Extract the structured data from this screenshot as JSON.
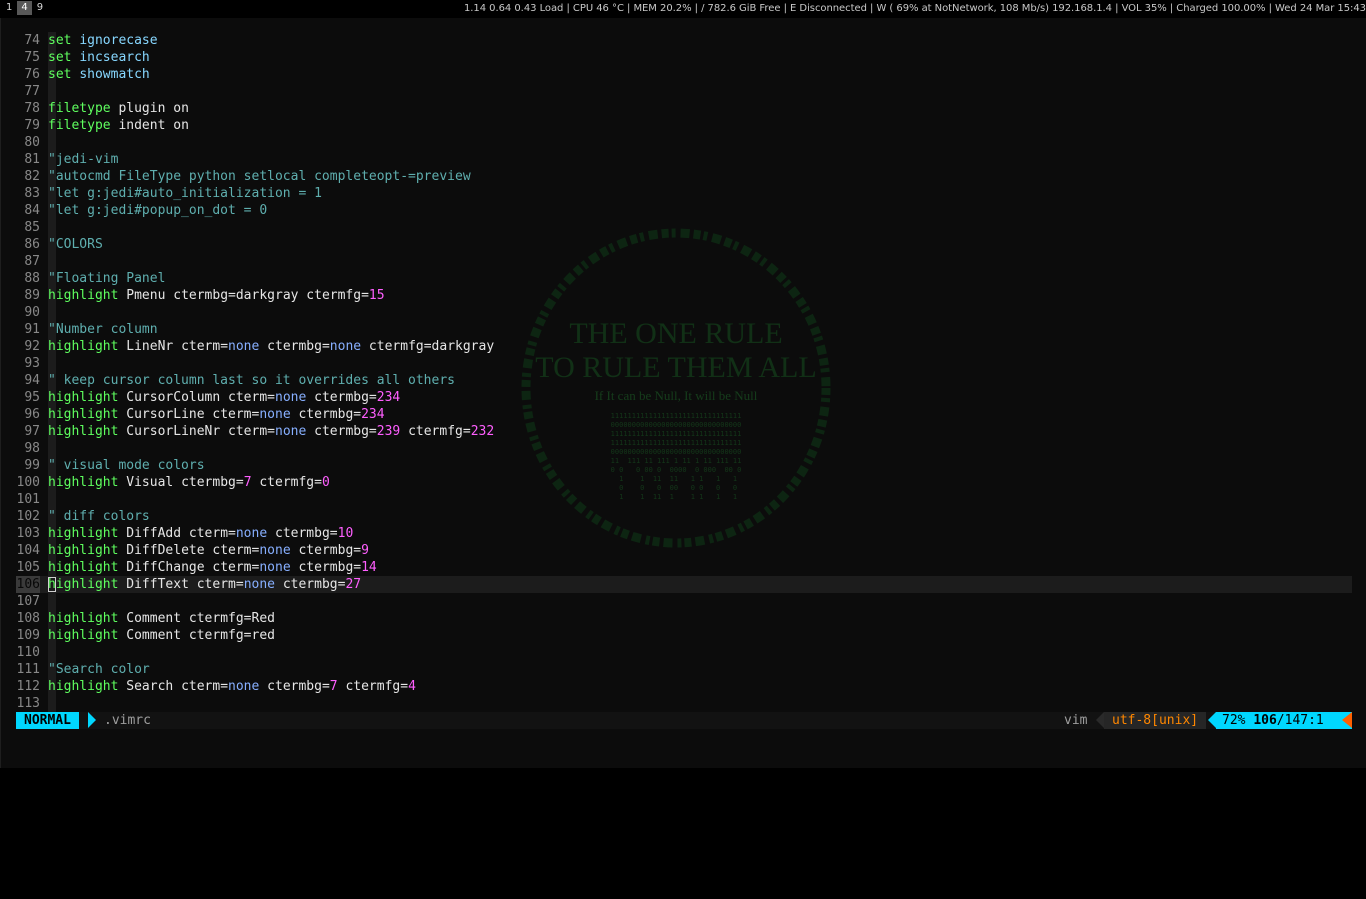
{
  "topbar": {
    "workspaces": [
      {
        "label": "1",
        "active": false
      },
      {
        "label": "4",
        "active": true
      },
      {
        "label": "9",
        "active": false
      }
    ],
    "status": "1.14 0.64 0.43 Load  | CPU 46 °C | MEM 20.2% | / 782.6 GiB Free | E Disconnected | W ( 69% at NotNetwork, 108 Mb/s) 192.168.1.4 | VOL 35% | Charged 100.00% | Wed 24 Mar 15:43"
  },
  "editor": {
    "lines": [
      {
        "n": "74",
        "tokens": [
          [
            "cmd",
            "set"
          ],
          [
            "plain",
            " "
          ],
          [
            "kw",
            "ignorecase"
          ]
        ]
      },
      {
        "n": "75",
        "tokens": [
          [
            "cmd",
            "set"
          ],
          [
            "plain",
            " "
          ],
          [
            "kw",
            "incsearch"
          ]
        ]
      },
      {
        "n": "76",
        "tokens": [
          [
            "cmd",
            "set"
          ],
          [
            "plain",
            " "
          ],
          [
            "kw",
            "showmatch"
          ]
        ]
      },
      {
        "n": "77",
        "tokens": []
      },
      {
        "n": "78",
        "tokens": [
          [
            "cmd",
            "filetype"
          ],
          [
            "plain",
            " plugin on"
          ]
        ]
      },
      {
        "n": "79",
        "tokens": [
          [
            "cmd",
            "filetype"
          ],
          [
            "plain",
            " indent on"
          ]
        ]
      },
      {
        "n": "80",
        "tokens": []
      },
      {
        "n": "81",
        "tokens": [
          [
            "cmt",
            "\"jedi-vim"
          ]
        ]
      },
      {
        "n": "82",
        "tokens": [
          [
            "cmt",
            "\"autocmd FileType python setlocal completeopt-=preview"
          ]
        ]
      },
      {
        "n": "83",
        "tokens": [
          [
            "cmt",
            "\"let g:jedi#auto_initialization = 1"
          ]
        ]
      },
      {
        "n": "84",
        "tokens": [
          [
            "cmt",
            "\"let g:jedi#popup_on_dot = 0"
          ]
        ]
      },
      {
        "n": "85",
        "tokens": []
      },
      {
        "n": "86",
        "tokens": [
          [
            "cmt",
            "\"COLORS"
          ]
        ]
      },
      {
        "n": "87",
        "tokens": []
      },
      {
        "n": "88",
        "tokens": [
          [
            "cmt",
            "\"Floating Panel"
          ]
        ]
      },
      {
        "n": "89",
        "tokens": [
          [
            "cmd",
            "highlight"
          ],
          [
            "plain",
            " Pmenu ctermbg=darkgray ctermfg="
          ],
          [
            "num",
            "15"
          ]
        ]
      },
      {
        "n": "90",
        "tokens": []
      },
      {
        "n": "91",
        "tokens": [
          [
            "cmt",
            "\"Number column"
          ]
        ]
      },
      {
        "n": "92",
        "tokens": [
          [
            "cmd",
            "highlight"
          ],
          [
            "plain",
            " LineNr cterm="
          ],
          [
            "none",
            "none"
          ],
          [
            "plain",
            " ctermbg="
          ],
          [
            "none",
            "none"
          ],
          [
            "plain",
            " ctermfg=darkgray"
          ]
        ]
      },
      {
        "n": "93",
        "tokens": []
      },
      {
        "n": "94",
        "tokens": [
          [
            "cmt",
            "\" keep cursor column last so it overrides all others"
          ]
        ]
      },
      {
        "n": "95",
        "tokens": [
          [
            "cmd",
            "highlight"
          ],
          [
            "plain",
            " CursorColumn cterm="
          ],
          [
            "none",
            "none"
          ],
          [
            "plain",
            " ctermbg="
          ],
          [
            "num",
            "234"
          ]
        ]
      },
      {
        "n": "96",
        "tokens": [
          [
            "cmd",
            "highlight"
          ],
          [
            "plain",
            " CursorLine cterm="
          ],
          [
            "none",
            "none"
          ],
          [
            "plain",
            " ctermbg="
          ],
          [
            "num",
            "234"
          ]
        ]
      },
      {
        "n": "97",
        "tokens": [
          [
            "cmd",
            "highlight"
          ],
          [
            "plain",
            " CursorLineNr cterm="
          ],
          [
            "none",
            "none"
          ],
          [
            "plain",
            " ctermbg="
          ],
          [
            "num",
            "239"
          ],
          [
            "plain",
            " ctermfg="
          ],
          [
            "num",
            "232"
          ]
        ]
      },
      {
        "n": "98",
        "tokens": []
      },
      {
        "n": "99",
        "tokens": [
          [
            "cmt",
            "\" visual mode colors"
          ]
        ]
      },
      {
        "n": "100",
        "tokens": [
          [
            "cmd",
            "highlight"
          ],
          [
            "plain",
            " Visual ctermbg="
          ],
          [
            "num",
            "7"
          ],
          [
            "plain",
            " ctermfg="
          ],
          [
            "num",
            "0"
          ]
        ]
      },
      {
        "n": "101",
        "tokens": []
      },
      {
        "n": "102",
        "tokens": [
          [
            "cmt",
            "\" diff colors"
          ]
        ]
      },
      {
        "n": "103",
        "tokens": [
          [
            "cmd",
            "highlight"
          ],
          [
            "plain",
            " DiffAdd cterm="
          ],
          [
            "none",
            "none"
          ],
          [
            "plain",
            " ctermbg="
          ],
          [
            "num",
            "10"
          ]
        ]
      },
      {
        "n": "104",
        "tokens": [
          [
            "cmd",
            "highlight"
          ],
          [
            "plain",
            " DiffDelete cterm="
          ],
          [
            "none",
            "none"
          ],
          [
            "plain",
            " ctermbg="
          ],
          [
            "num",
            "9"
          ]
        ]
      },
      {
        "n": "105",
        "tokens": [
          [
            "cmd",
            "highlight"
          ],
          [
            "plain",
            " DiffChange cterm="
          ],
          [
            "none",
            "none"
          ],
          [
            "plain",
            " ctermbg="
          ],
          [
            "num",
            "14"
          ]
        ]
      },
      {
        "n": "106",
        "tokens": [
          [
            "cmd",
            "highlight"
          ],
          [
            "plain",
            " DiffText cterm="
          ],
          [
            "none",
            "none"
          ],
          [
            "plain",
            " ctermbg="
          ],
          [
            "num",
            "27"
          ]
        ],
        "cursor": true
      },
      {
        "n": "107",
        "tokens": []
      },
      {
        "n": "108",
        "tokens": [
          [
            "cmd",
            "highlight"
          ],
          [
            "plain",
            " Comment ctermfg=Red"
          ]
        ]
      },
      {
        "n": "109",
        "tokens": [
          [
            "cmd",
            "highlight"
          ],
          [
            "plain",
            " Comment ctermfg=red"
          ]
        ]
      },
      {
        "n": "110",
        "tokens": []
      },
      {
        "n": "111",
        "tokens": [
          [
            "cmt",
            "\"Search color"
          ]
        ]
      },
      {
        "n": "112",
        "tokens": [
          [
            "cmd",
            "highlight"
          ],
          [
            "plain",
            " Search cterm="
          ],
          [
            "none",
            "none"
          ],
          [
            "plain",
            " ctermbg="
          ],
          [
            "num",
            "7"
          ],
          [
            "plain",
            " ctermfg="
          ],
          [
            "num",
            "4"
          ]
        ]
      },
      {
        "n": "113",
        "tokens": []
      }
    ]
  },
  "wallpaper": {
    "title_line1": "THE ONE RULE",
    "title_line2": "TO RULE THEM ALL",
    "subtitle": "If It can be Null, It will be Null",
    "binary_rows": [
      "1111111111111111111111111111111",
      "0000000000000000000000000000000",
      "1111111111111111111111111111111",
      "1111111111111111111111111111111",
      "0000000000000000000000000000000",
      "11  111 11 111 1 11 1 11 111 11",
      "0 0   0 00 0  0000  0 000  00 0",
      "  1    1  11  11   1 1   1   1 ",
      "  0    0   0  00   0 0   0   0 ",
      "  1    1  11  1    1 1   1   1 "
    ]
  },
  "vim_status": {
    "mode": "NORMAL",
    "filename": ".vimrc",
    "filetype": "vim",
    "encoding": "utf-8[unix]",
    "percent": "72%",
    "line": "106",
    "total": "/147",
    "col": ":1"
  },
  "colors": {
    "mode_bg": "#00d7ff",
    "command": "#5fff5f",
    "keyword": "#87d7ff",
    "number": "#ff5fff",
    "comment": "#5fafaf",
    "encoding_fg": "#ff8700"
  }
}
